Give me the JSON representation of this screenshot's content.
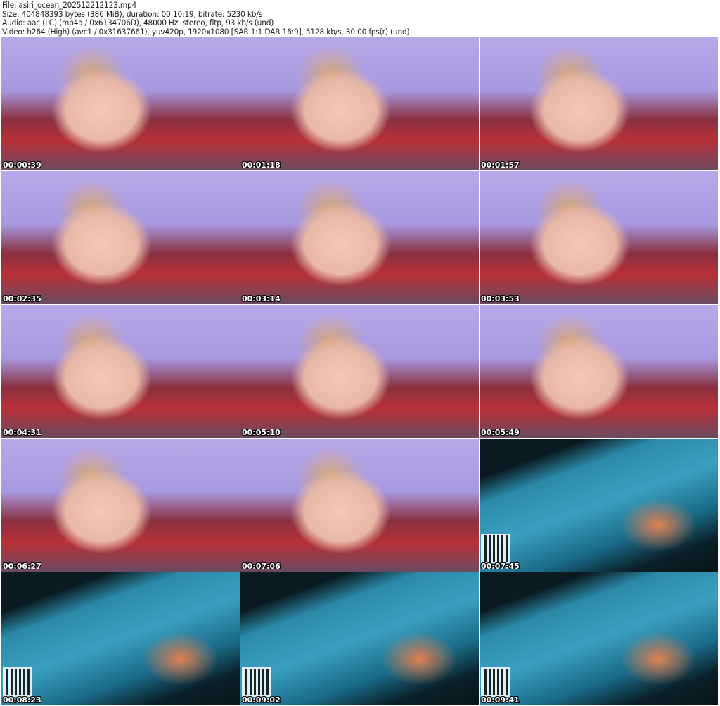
{
  "header": {
    "file_line": "File: asiri_ocean_202512212123.mp4",
    "size_line": "Size: 404848393 bytes (386 MiB), duration: 00:10:19, bitrate: 5230 kb/s",
    "audio_line": "Audio: aac (LC) (mp4a / 0x6134706D), 48000 Hz, stereo, fltp, 93 kb/s (und)",
    "video_line": "Video: h264 (High) (avc1 / 0x31637661), yuv420p, 1920x1080 [SAR 1:1 DAR 16:9], 5128 kb/s, 30.00 fps(r) (und)"
  },
  "thumbnails": [
    {
      "time": "00:00:39",
      "scene": "room"
    },
    {
      "time": "00:01:18",
      "scene": "room"
    },
    {
      "time": "00:01:57",
      "scene": "room"
    },
    {
      "time": "00:02:35",
      "scene": "room"
    },
    {
      "time": "00:03:14",
      "scene": "room"
    },
    {
      "time": "00:03:53",
      "scene": "room"
    },
    {
      "time": "00:04:31",
      "scene": "room"
    },
    {
      "time": "00:05:10",
      "scene": "room"
    },
    {
      "time": "00:05:49",
      "scene": "room"
    },
    {
      "time": "00:06:27",
      "scene": "room"
    },
    {
      "time": "00:07:06",
      "scene": "room"
    },
    {
      "time": "00:07:45",
      "scene": "ocean"
    },
    {
      "time": "00:08:23",
      "scene": "ocean"
    },
    {
      "time": "00:09:02",
      "scene": "ocean"
    },
    {
      "time": "00:09:41",
      "scene": "ocean"
    }
  ]
}
